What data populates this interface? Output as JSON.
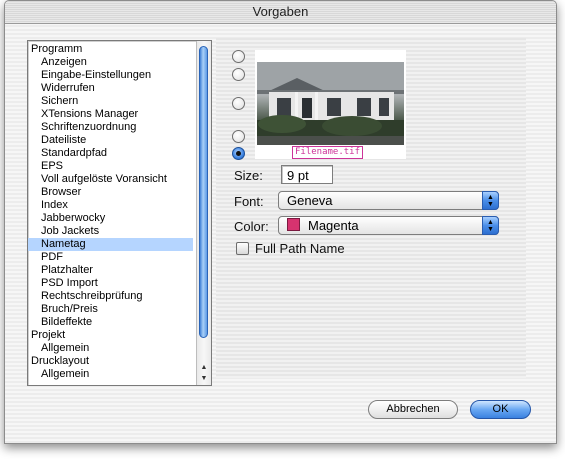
{
  "window": {
    "title": "Vorgaben"
  },
  "sidebar": {
    "items": [
      {
        "label": "Programm",
        "level": 0
      },
      {
        "label": "Anzeigen",
        "level": 1
      },
      {
        "label": "Eingabe-Einstellungen",
        "level": 1
      },
      {
        "label": "Widerrufen",
        "level": 1
      },
      {
        "label": "Sichern",
        "level": 1
      },
      {
        "label": "XTensions Manager",
        "level": 1
      },
      {
        "label": "Schriftenzuordnung",
        "level": 1
      },
      {
        "label": "Dateiliste",
        "level": 1
      },
      {
        "label": "Standardpfad",
        "level": 1
      },
      {
        "label": "EPS",
        "level": 1
      },
      {
        "label": "Voll aufgelöste Voransicht",
        "level": 1
      },
      {
        "label": "Browser",
        "level": 1
      },
      {
        "label": "Index",
        "level": 1
      },
      {
        "label": "Jabberwocky",
        "level": 1
      },
      {
        "label": "Job Jackets",
        "level": 1
      },
      {
        "label": "Nametag",
        "level": 1,
        "selected": true
      },
      {
        "label": "PDF",
        "level": 1
      },
      {
        "label": "Platzhalter",
        "level": 1
      },
      {
        "label": "PSD Import",
        "level": 1
      },
      {
        "label": "Rechtschreibprüfung",
        "level": 1
      },
      {
        "label": "Bruch/Preis",
        "level": 1
      },
      {
        "label": "Bildeffekte",
        "level": 1
      },
      {
        "label": "Projekt",
        "level": 0
      },
      {
        "label": "Allgemein",
        "level": 1
      },
      {
        "label": "Drucklayout",
        "level": 0
      },
      {
        "label": "Allgemein",
        "level": 1
      }
    ]
  },
  "nametag": {
    "preview_filename": "Filename.tif",
    "position_selected": 5,
    "size_label": "Size:",
    "size_value": "9 pt",
    "font_label": "Font:",
    "font_value": "Geneva",
    "color_label": "Color:",
    "color_value": "Magenta",
    "color_swatch": "#d6336f",
    "full_path_label": "Full Path Name",
    "full_path_checked": false
  },
  "buttons": {
    "cancel": "Abbrechen",
    "ok": "OK"
  },
  "colors": {
    "accent": "#3b82e0",
    "selection": "#b5d5ff",
    "label_magenta": "#cc3399"
  }
}
